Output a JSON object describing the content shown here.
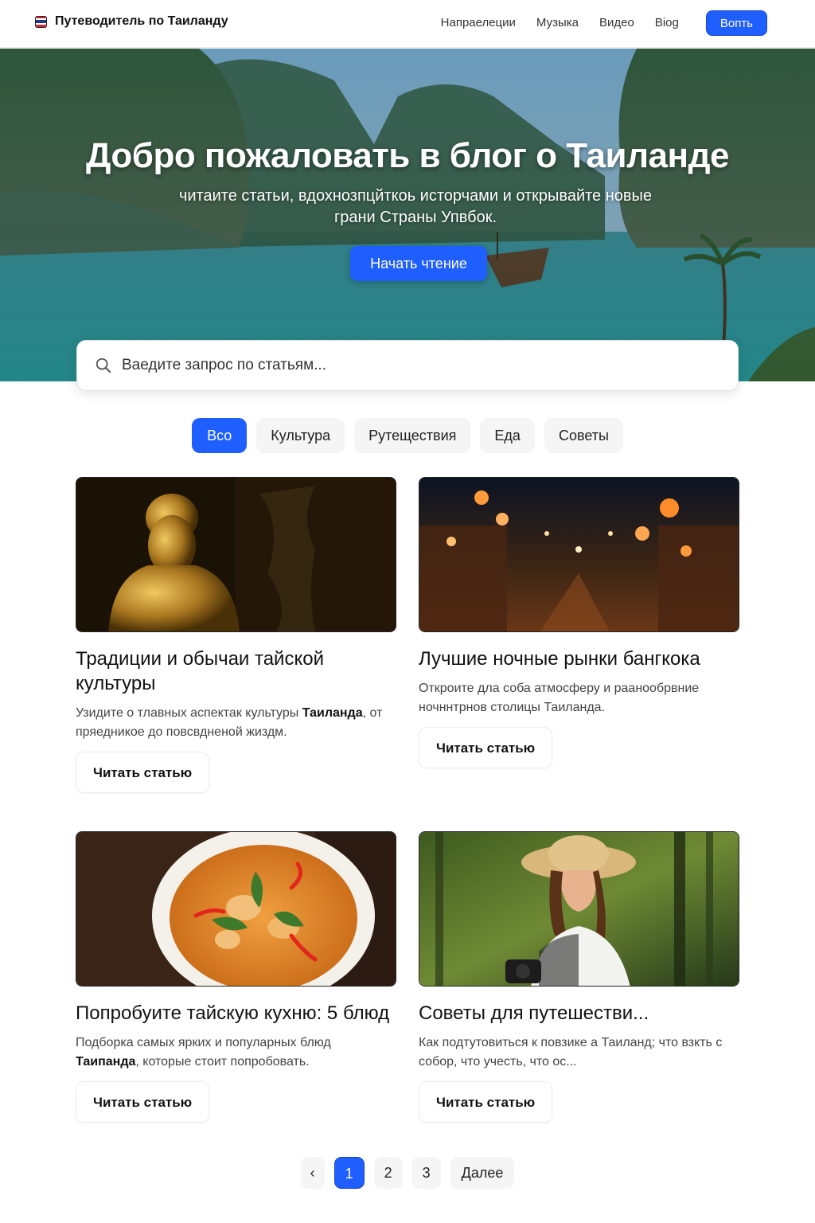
{
  "header": {
    "brand": "Путеводитель по Таиланду",
    "nav": [
      "Напраелеции",
      "Музыка",
      "Видео",
      "Biog"
    ],
    "login": "Вопть"
  },
  "hero": {
    "title": "Добро пожаловать в блог о Таиланде",
    "subtitle": "читаите статьи, вдохнозпцйткоь исторчами и открывайте новые грани Страны Упвбок.",
    "cta": "Начать чтение"
  },
  "search": {
    "placeholder": "Ваедите запрос по статьям..."
  },
  "filters": [
    "Всо",
    "Культура",
    "Рутеществия",
    "Еда",
    "Советы"
  ],
  "cards": [
    {
      "image": "golden-buddy-statue",
      "title": "Традиции и обычаи тайской культуры",
      "desc_pre": "Узидите о тлавных аспектак культуры",
      "desc_bold": "Таиланда",
      "desc_post": ", от пряедникое до повсвдненой жиздм.",
      "button": "Читать статью"
    },
    {
      "image": "night-market",
      "title": "Лучшие ночные рынки бангкока",
      "desc_pre": "Откроите дла соба атмосферу и раанообрвние ночннтрнов столицы Таиланда.",
      "desc_bold": "",
      "desc_post": "",
      "button": "Читать статью"
    },
    {
      "image": "thai-curry",
      "title": "Попробуите тайскую кухню: 5 блюд",
      "desc_pre": "Подборка самых ярких и популарных блюд",
      "desc_bold": "Таипанда",
      "desc_post": ", которые стоит попробовать.",
      "button": "Читать статью"
    },
    {
      "image": "traveler-woman",
      "title": "Советы для путешестви...",
      "desc_pre": "Как подтутовиться к повзике а Таиланд; что взкть с собор, что учесть, что ос...",
      "desc_bold": "",
      "desc_post": "",
      "button": "Читать статью"
    }
  ],
  "pagination": {
    "prev": "‹",
    "pages": [
      "1",
      "2",
      "3"
    ],
    "current": "1",
    "next": "Далее"
  },
  "colors": {
    "accent": "#1f5eff"
  }
}
